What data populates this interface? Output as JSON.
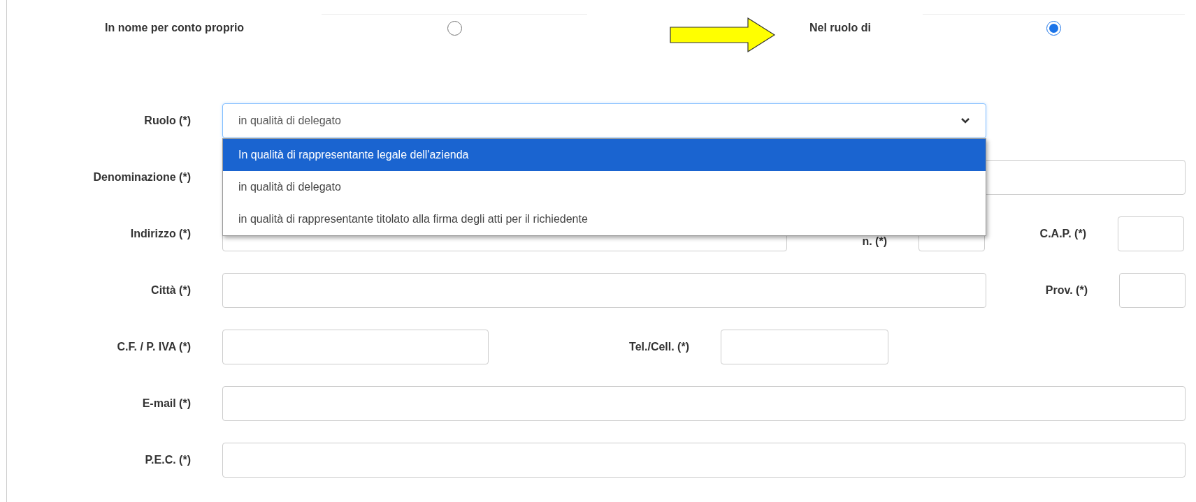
{
  "choices": [
    {
      "label": "In nome per conto proprio",
      "selected": false
    },
    {
      "label": "Nel ruolo di",
      "selected": true
    }
  ],
  "role_select": {
    "label": "Ruolo (*)",
    "value": "in qualità di delegato",
    "expanded": true,
    "options": [
      {
        "label": "In qualità di rappresentante legale dell'azienda",
        "highlighted": true
      },
      {
        "label": "in qualità di delegato",
        "highlighted": false
      },
      {
        "label": "in qualità di rappresentante titolato alla firma degli atti per il richiedente",
        "highlighted": false
      }
    ]
  },
  "rows": [
    {
      "fields": [
        {
          "label": "Denominazione (*)"
        }
      ]
    },
    {
      "fields": [
        {
          "label": "Indirizzo (*)"
        },
        {
          "label": "n. (*)"
        },
        {
          "label": "C.A.P. (*)"
        }
      ]
    },
    {
      "fields": [
        {
          "label": "Città (*)"
        },
        {
          "label": "Prov. (*)"
        }
      ]
    },
    {
      "fields": [
        {
          "label": "C.F. / P. IVA (*)"
        },
        {
          "label": "Tel./Cell. (*)"
        }
      ]
    },
    {
      "fields": [
        {
          "label": "E-mail (*)"
        }
      ]
    },
    {
      "fields": [
        {
          "label": "P.E.C. (*)"
        }
      ]
    }
  ]
}
